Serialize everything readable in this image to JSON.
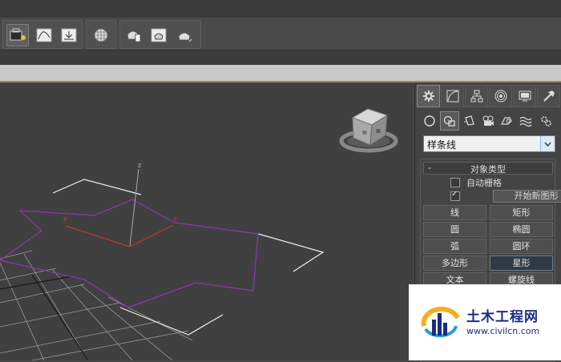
{
  "toolbar": {
    "buttons": [
      "layer-manager-icon",
      "curve-editor-icon",
      "schematic-icon",
      "material-editor-icon",
      "render-setup-icon",
      "rendered-frame-icon",
      "render-icon"
    ]
  },
  "viewport": {
    "axis_labels": {
      "z": "z",
      "y": "y",
      "x": "x"
    }
  },
  "command_panel": {
    "tabs": [
      "create-tab",
      "modify-tab",
      "hierarchy-tab",
      "motion-tab",
      "display-tab",
      "utilities-tab"
    ],
    "categories": [
      "geometry",
      "shapes",
      "lights",
      "cameras",
      "helpers",
      "space-warps",
      "systems"
    ],
    "dropdown_value": "样条线",
    "rollout_title": "对象类型",
    "rollout_minus": "-",
    "auto_grid_label": "自动栅格",
    "start_new_shape_label": "开始新图形",
    "start_new_shape_checked": true,
    "auto_grid_checked": false,
    "buttons": [
      [
        "线",
        "矩形"
      ],
      [
        "圆",
        "椭圆"
      ],
      [
        "弧",
        "圆环"
      ],
      [
        "多边形",
        "星形"
      ],
      [
        "文本",
        "螺旋线"
      ]
    ],
    "active_button": "星形"
  },
  "watermark": {
    "title": "土木工程网",
    "url": "www.civilcn.com"
  },
  "colors": {
    "star_spline": "#8a3aa8",
    "x_axis": "#c0392b",
    "grid": "#9a9a9a",
    "viewport_bg": "#404040",
    "watermark_text": "#1b2c84"
  }
}
